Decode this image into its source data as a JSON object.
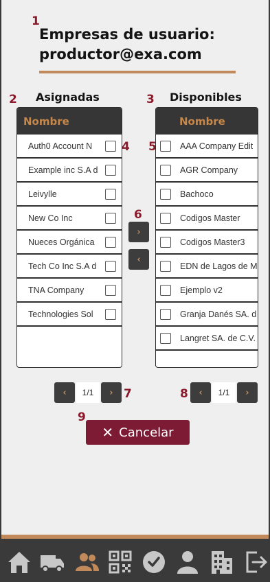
{
  "markers": [
    "1",
    "2",
    "3",
    "4",
    "5",
    "6",
    "7",
    "8",
    "9"
  ],
  "header": {
    "title_line1": "Empresas de usuario:",
    "title_line2": "productor@exa.com"
  },
  "assigned": {
    "heading": "Asignadas",
    "column": "Nombre",
    "items": [
      "Auth0 Account N",
      "Example inc S.A d",
      "Leivylle",
      "New Co Inc",
      "Nueces Orgánica",
      "Tech Co Inc S.A d",
      "TNA Company",
      "Technologies Sol"
    ],
    "pager": {
      "prev": "‹",
      "page": "1/1",
      "next": "›"
    }
  },
  "available": {
    "heading": "Disponibles",
    "column": "Nombre",
    "items": [
      "AAA Company Edit",
      "AGR Company",
      "Bachoco",
      "Codigos Master",
      "Codigos Master3",
      "EDN de Lagos de M",
      "Ejemplo v2",
      "Granja Danés SA. d",
      "Langret SA. de C.V."
    ],
    "pager": {
      "prev": "‹",
      "page": "1/1",
      "next": "›"
    }
  },
  "transfer": {
    "to_available": "›",
    "to_assigned": "‹"
  },
  "cancel": {
    "icon": "✕",
    "label": "Cancelar"
  },
  "colors": {
    "accent": "#c28a5a",
    "header_bg": "#363636",
    "cancel_bg": "#7d1b34",
    "marker": "#8b1a2b",
    "nav_icon_active": "#c28a5a",
    "nav_icon": "#c8c8c8"
  },
  "bottom_nav": [
    "home-icon",
    "truck-icon",
    "users-icon",
    "qr-code-icon",
    "check-circle-icon",
    "user-icon",
    "building-icon",
    "logout-icon"
  ]
}
